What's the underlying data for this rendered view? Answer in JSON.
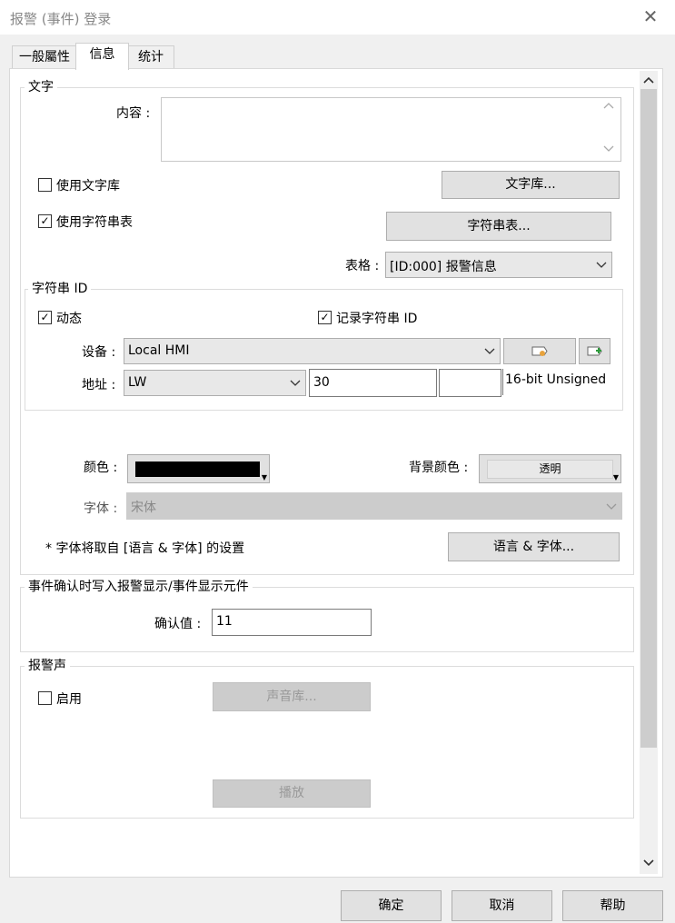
{
  "window": {
    "title": "报警 (事件) 登录",
    "close_glyph": "✕"
  },
  "tabs": [
    {
      "label": "一般屬性",
      "active": false
    },
    {
      "label": "信息",
      "active": true
    },
    {
      "label": "统计",
      "active": false
    }
  ],
  "text_group": {
    "legend": "文字",
    "content_label": "内容 :",
    "content_value": "",
    "use_text_library_label": "使用文字库",
    "use_text_library_checked": false,
    "text_library_button": "文字库...",
    "use_string_table_label": "使用字符串表",
    "use_string_table_checked": true,
    "string_table_button": "字符串表...",
    "table_label": "表格 :",
    "table_value": "[ID:000] 报警信息"
  },
  "string_id_group": {
    "legend": "字符串 ID",
    "dynamic_label": "动态",
    "dynamic_checked": true,
    "record_label": "记录字符串 ID",
    "record_checked": true,
    "device_label": "设备 :",
    "device_value": "Local HMI",
    "address_label": "地址 :",
    "address_type": "LW",
    "address_value": "30",
    "address_extra": "",
    "data_format": "16-bit Unsigned"
  },
  "appearance": {
    "color_label": "颜色 :",
    "color_value": "#000000",
    "bg_color_label": "背景颜色 :",
    "bg_color_value": "透明",
    "font_label": "字体 :",
    "font_value": "宋体",
    "note": "* 字体将取自 [语言 & 字体] 的设置",
    "language_button": "语言 & 字体..."
  },
  "event_confirm": {
    "legend": "事件确认时写入报警显示/事件显示元件",
    "confirm_label": "确认值 :",
    "confirm_value": "11"
  },
  "alarm_sound": {
    "legend": "报警声",
    "enable_label": "启用",
    "enable_checked": false,
    "sound_library_button": "声音库...",
    "play_button": "播放"
  },
  "footer": {
    "ok": "确定",
    "cancel": "取消",
    "help": "帮助"
  },
  "icons": {
    "scroll_up": "chevron-up-icon",
    "scroll_down": "chevron-down-icon",
    "dropdown": "chevron-down-icon",
    "tag_picker": "tag-icon",
    "tag_add": "tag-add-icon"
  }
}
